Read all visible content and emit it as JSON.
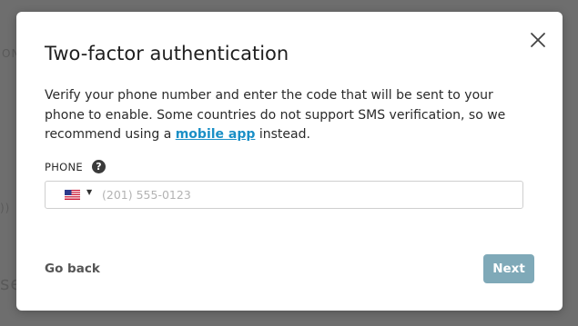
{
  "modal": {
    "title": "Two-factor authentication",
    "description_pre": "Verify your phone number and enter the code that will be sent to your phone to enable. Some countries do not support SMS verification, so we recommend using a ",
    "description_link": "mobile app",
    "description_post": " instead."
  },
  "phone": {
    "label": "PHONE",
    "help_glyph": "?",
    "country_flag": "us-flag-icon",
    "placeholder": "(201) 555-0123",
    "value": ""
  },
  "actions": {
    "back_label": "Go back",
    "next_label": "Next"
  },
  "colors": {
    "link": "#1a8fc6",
    "next_button": "#7fa9b8",
    "backdrop": "#6e6e6e"
  }
}
